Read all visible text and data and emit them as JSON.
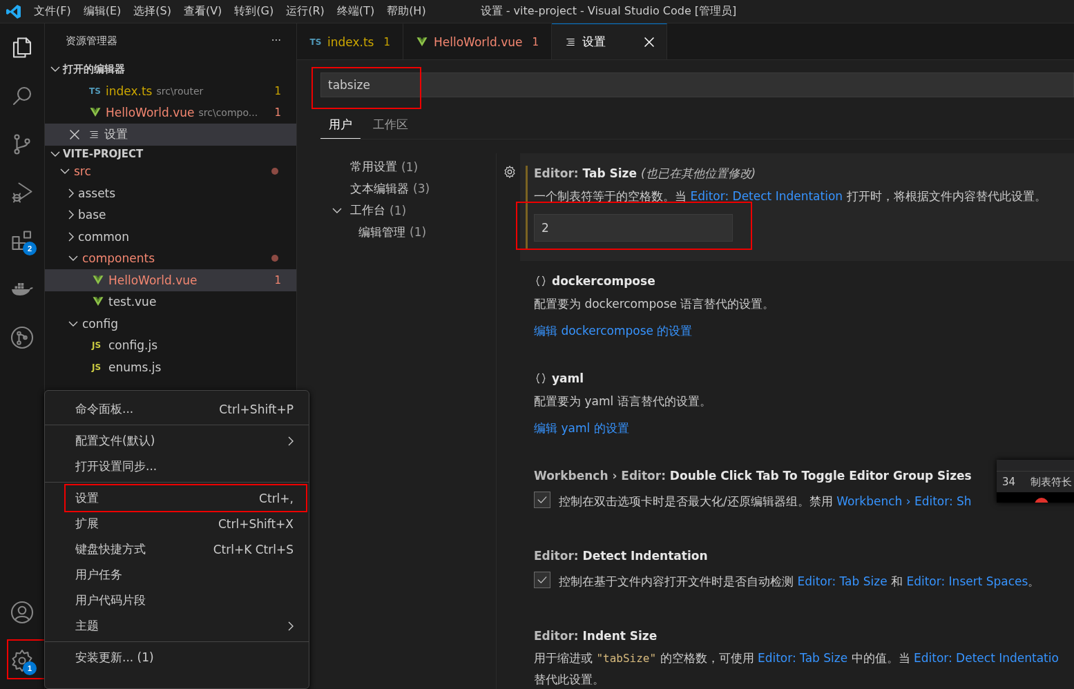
{
  "title_bar": {
    "menus": [
      "文件(F)",
      "编辑(E)",
      "选择(S)",
      "查看(V)",
      "转到(G)",
      "运行(R)",
      "终端(T)",
      "帮助(H)"
    ],
    "title": "设置 - vite-project - Visual Studio Code [管理员]"
  },
  "activity_bar": {
    "top": [
      {
        "kind": "explorer",
        "selected": true
      },
      {
        "kind": "search",
        "selected": false
      },
      {
        "kind": "scm",
        "selected": false
      },
      {
        "kind": "debug",
        "selected": false
      },
      {
        "kind": "extensions",
        "selected": false,
        "badge": "2"
      },
      {
        "kind": "docker",
        "selected": false
      },
      {
        "kind": "gitgraph",
        "selected": false
      }
    ],
    "bottom": [
      {
        "kind": "account",
        "selected": false
      },
      {
        "kind": "manage",
        "selected": false,
        "badge": "1",
        "highlighted": true
      }
    ]
  },
  "sidebar": {
    "title": "资源管理器",
    "more": "···",
    "open_editors": {
      "title": "打开的编辑器",
      "expanded": true,
      "items": [
        {
          "kind": "ts",
          "icon_text": "TS",
          "name": "index.ts",
          "path": "src\\router",
          "badge": "1",
          "color": "#cca700",
          "selected": false,
          "closable": false
        },
        {
          "kind": "vue",
          "name": "HelloWorld.vue",
          "path": "src\\compo...",
          "badge": "1",
          "color": "#f48771",
          "selected": false,
          "closable": false
        },
        {
          "kind": "settings",
          "name": "设置",
          "selected": true,
          "closable": true
        }
      ]
    },
    "project": {
      "title": "VITE-PROJECT",
      "expanded": true,
      "tree": [
        {
          "kind": "folder",
          "name": "src",
          "expanded": true,
          "color": "#f48771",
          "dot": true,
          "selected": false,
          "children": [
            {
              "kind": "folder",
              "name": "assets",
              "expanded": false,
              "selected": false
            },
            {
              "kind": "folder",
              "name": "base",
              "expanded": false,
              "selected": false
            },
            {
              "kind": "folder",
              "name": "common",
              "expanded": false,
              "selected": false
            },
            {
              "kind": "folder",
              "name": "components",
              "expanded": true,
              "color": "#f48771",
              "dot": true,
              "selected": false,
              "children": [
                {
                  "kind": "vue",
                  "name": "HelloWorld.vue",
                  "color": "#f48771",
                  "badge": "1",
                  "selected": true
                },
                {
                  "kind": "vue",
                  "name": "test.vue",
                  "selected": false
                }
              ]
            },
            {
              "kind": "folder",
              "name": "config",
              "expanded": true,
              "selected": false,
              "children": [
                {
                  "kind": "js",
                  "icon_text": "JS",
                  "name": "config.js",
                  "selected": false
                },
                {
                  "kind": "js",
                  "icon_text": "JS",
                  "name": "enums.js",
                  "selected": false
                }
              ]
            }
          ]
        }
      ]
    }
  },
  "editor_tabs": [
    {
      "kind": "ts",
      "icon_text": "TS",
      "label": "index.ts",
      "badge": "1",
      "color": "#cca700",
      "selected": false,
      "closable": false
    },
    {
      "kind": "vue",
      "label": "HelloWorld.vue",
      "badge": "1",
      "color": "#f48771",
      "selected": false,
      "closable": false
    },
    {
      "kind": "settings",
      "label": "设置",
      "selected": true,
      "closable": true
    }
  ],
  "settings": {
    "search": {
      "value": "tabsize",
      "highlighted": true
    },
    "scopes": [
      {
        "label": "用户",
        "selected": true
      },
      {
        "label": "工作区",
        "selected": false
      }
    ],
    "toc": [
      {
        "label": "常用设置",
        "count": "(1)"
      },
      {
        "label": "文本编辑器",
        "count": "(3)"
      },
      {
        "label": "工作台",
        "count": "(1)",
        "expanded": true,
        "children": [
          {
            "label": "编辑管理",
            "count": "(1)"
          }
        ]
      }
    ],
    "items": [
      {
        "kind": "number",
        "category": "Editor: ",
        "name": "Tab Size",
        "note": "(也已在其他位置修改)",
        "modified": true,
        "description": [
          [
            {
              "kind": "text",
              "text": "一个制表符等于的空格数。当 "
            },
            {
              "kind": "link",
              "text": "Editor: Detect Indentation"
            },
            {
              "kind": "text",
              "text": " 打开时，将根据文件内容替代此设置。"
            }
          ]
        ],
        "value": "2",
        "highlighted": true
      },
      {
        "kind": "extension",
        "name": "dockercompose",
        "modified": false,
        "description": [
          [
            {
              "kind": "text",
              "text": "配置要为 dockercompose 语言替代的设置。"
            }
          ]
        ],
        "link": "编辑 dockercompose 的设置"
      },
      {
        "kind": "extension",
        "name": "yaml",
        "modified": false,
        "description": [
          [
            {
              "kind": "text",
              "text": "配置要为 yaml 语言替代的设置。"
            }
          ]
        ],
        "link": "编辑 yaml 的设置"
      },
      {
        "kind": "checkbox",
        "category": "Workbench › Editor: ",
        "name": "Double Click Tab To Toggle Editor Group Sizes",
        "modified": false,
        "checked": true,
        "description": [
          [
            {
              "kind": "text",
              "text": "控制在双击选项卡时是否最大化/还原编辑器组。禁用 "
            },
            {
              "kind": "link",
              "text": "Workbench › Editor: Sh"
            }
          ]
        ],
        "popup": {
          "number": "34",
          "label": "制表符长"
        }
      },
      {
        "kind": "checkbox",
        "category": "Editor: ",
        "name": "Detect Indentation",
        "modified": false,
        "checked": true,
        "description": [
          [
            {
              "kind": "text",
              "text": "控制在基于文件内容打开文件时是否自动检测 "
            },
            {
              "kind": "link",
              "text": "Editor: Tab Size"
            },
            {
              "kind": "text",
              "text": " 和 "
            },
            {
              "kind": "link",
              "text": "Editor: Insert Spaces"
            },
            {
              "kind": "text",
              "text": "。"
            }
          ]
        ]
      },
      {
        "kind": "text",
        "category": "Editor: ",
        "name": "Indent Size",
        "modified": false,
        "description": [
          [
            {
              "kind": "text",
              "text": "用于缩进或 "
            },
            {
              "kind": "code",
              "text": "\"tabSize\""
            },
            {
              "kind": "text",
              "text": " 的空格数，可使用 "
            },
            {
              "kind": "link",
              "text": "Editor: Tab Size"
            },
            {
              "kind": "text",
              "text": " 中的值。当 "
            },
            {
              "kind": "link",
              "text": "Editor: Detect Indentatio"
            }
          ],
          [
            {
              "kind": "text",
              "text": "替代此设置。"
            }
          ]
        ]
      }
    ]
  },
  "context_menu": {
    "groups": [
      [
        {
          "label": "命令面板...",
          "shortcut": "Ctrl+Shift+P",
          "submenu": false,
          "highlighted": false
        }
      ],
      [
        {
          "label": "配置文件(默认)",
          "submenu": true,
          "highlighted": false
        },
        {
          "label": "打开设置同步...",
          "submenu": false,
          "highlighted": false
        }
      ],
      [
        {
          "label": "设置",
          "shortcut": "Ctrl+,",
          "submenu": false,
          "highlighted": true
        },
        {
          "label": "扩展",
          "shortcut": "Ctrl+Shift+X",
          "submenu": false,
          "highlighted": false
        },
        {
          "label": "键盘快捷方式",
          "shortcut": "Ctrl+K Ctrl+S",
          "submenu": false,
          "highlighted": false
        },
        {
          "label": "用户任务",
          "submenu": false,
          "highlighted": false
        },
        {
          "label": "用户代码片段",
          "submenu": false,
          "highlighted": false
        },
        {
          "label": "主题",
          "submenu": true,
          "highlighted": false
        }
      ],
      [
        {
          "label": "安装更新... (1)",
          "submenu": false,
          "highlighted": false
        }
      ]
    ]
  }
}
